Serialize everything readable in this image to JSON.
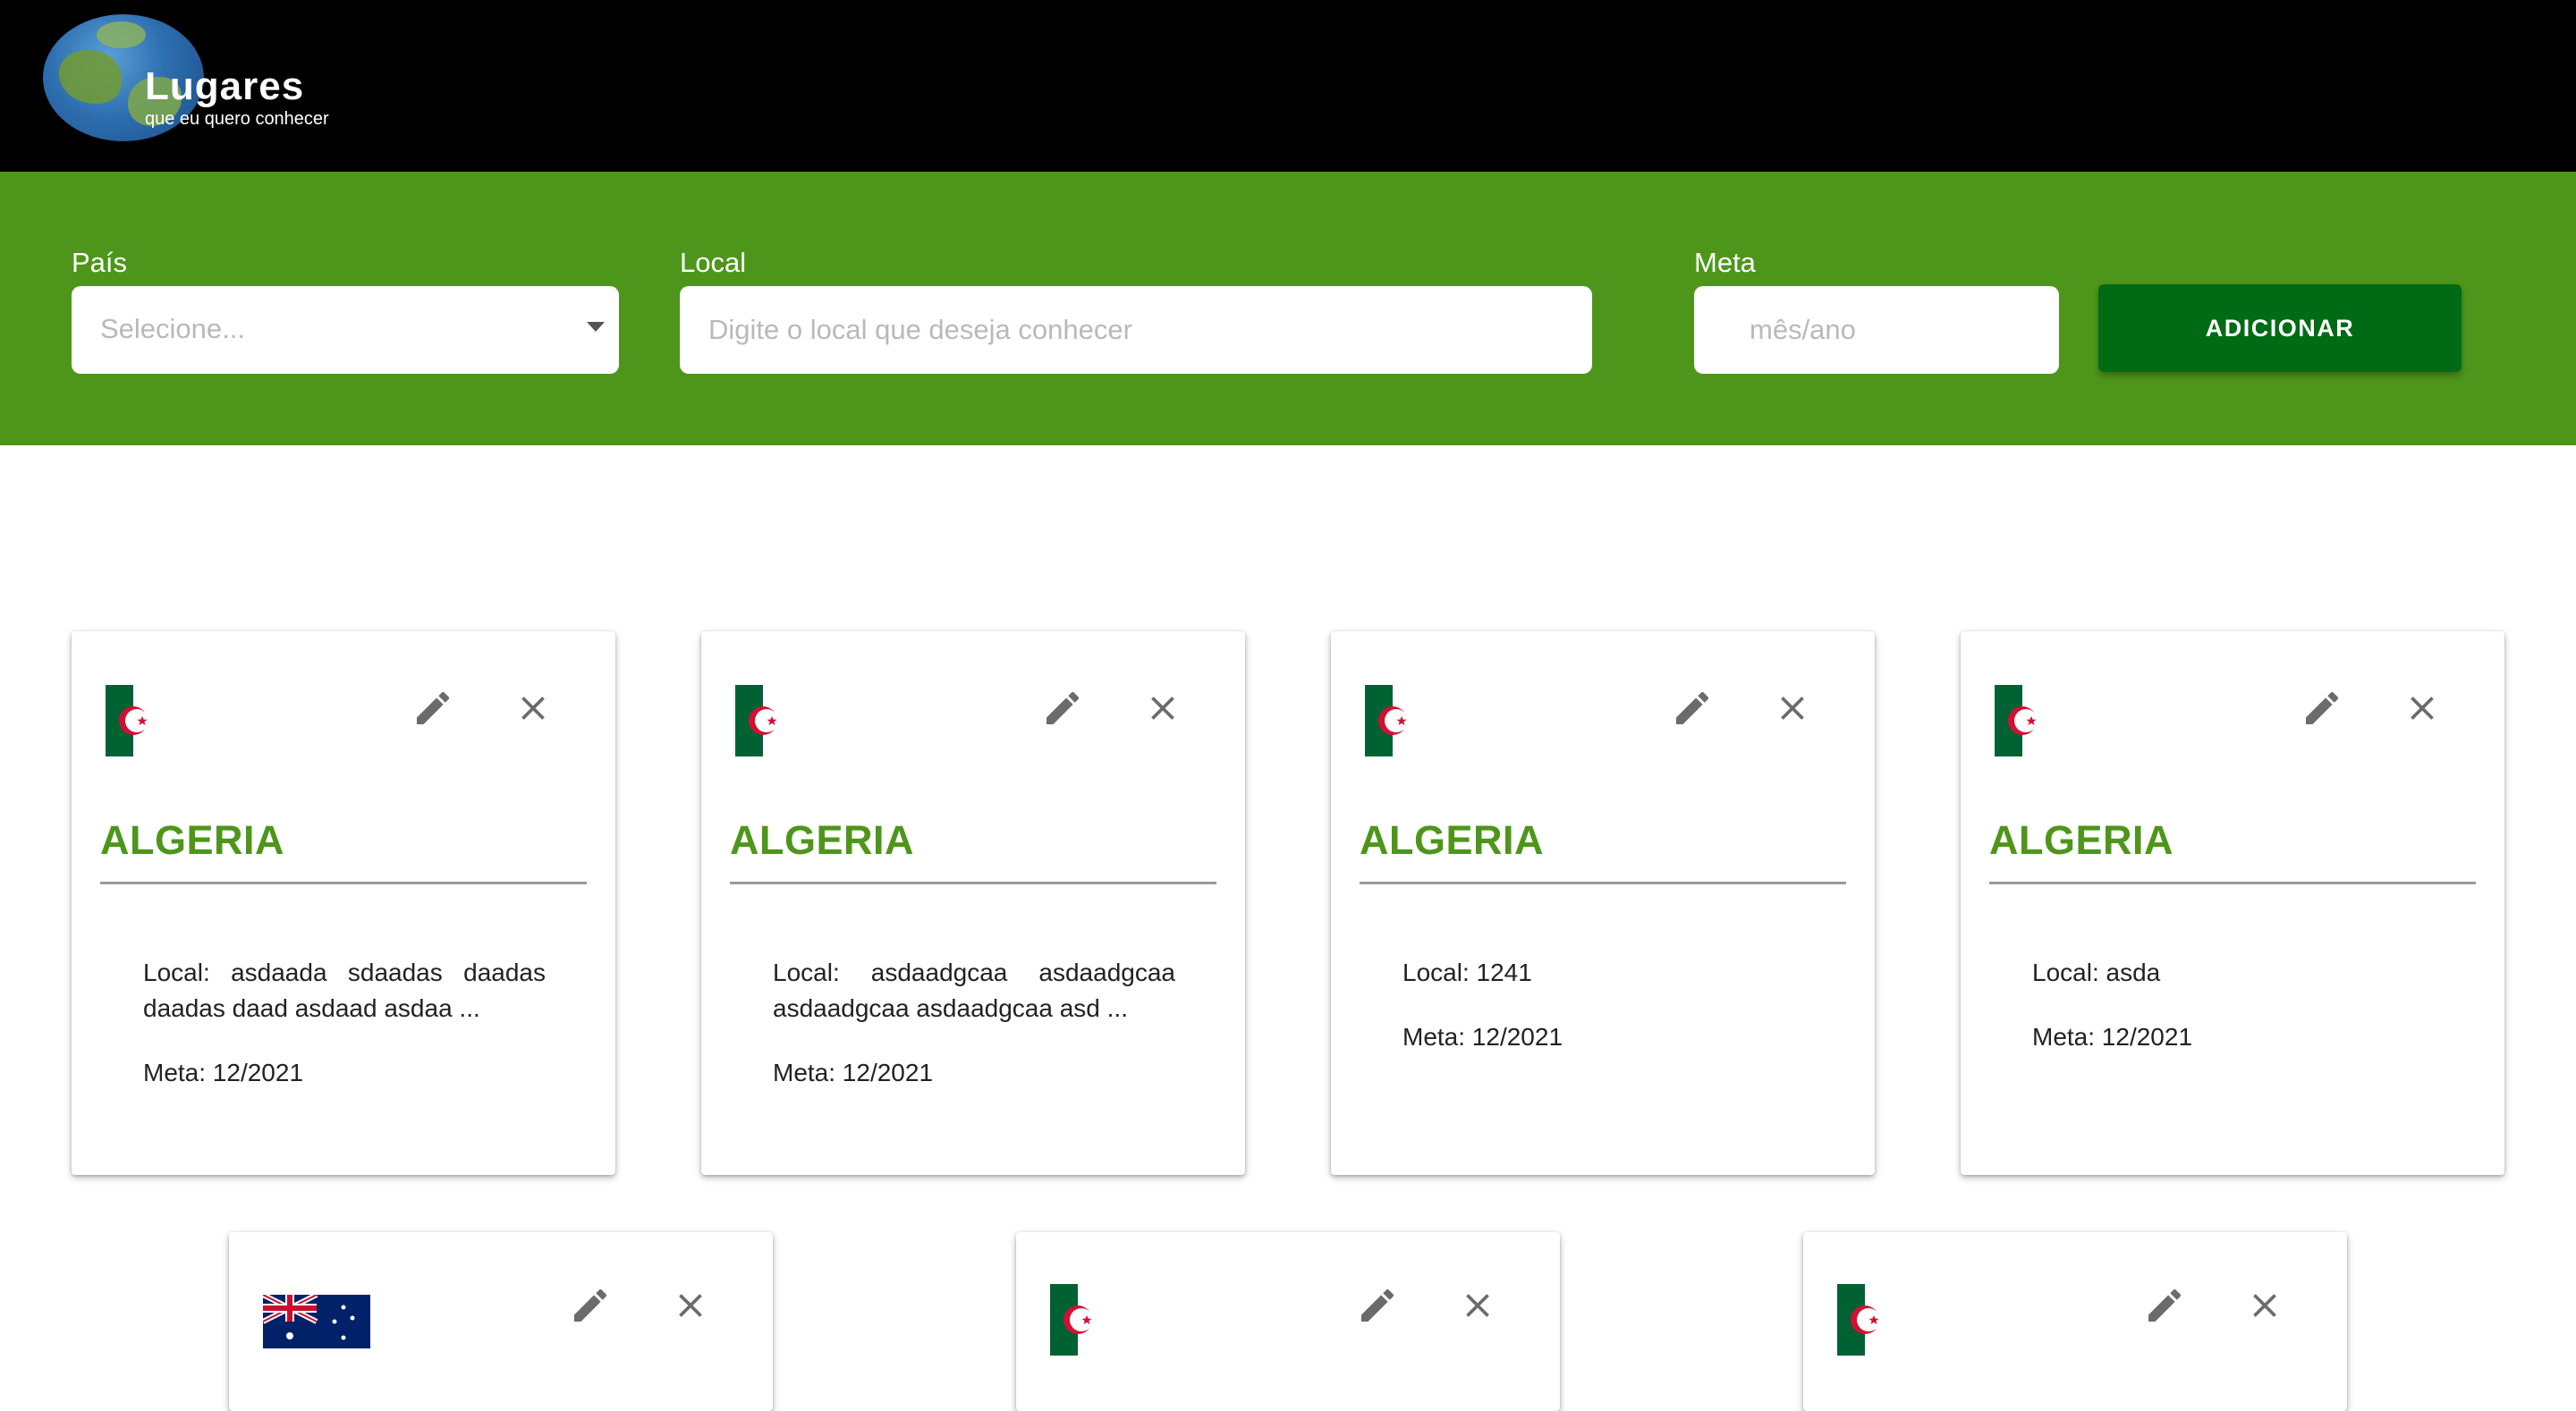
{
  "header": {
    "logo_title": "Lugares",
    "logo_subtitle": "que eu quero conhecer"
  },
  "form": {
    "country_label": "País",
    "country_placeholder": "Selecione...",
    "local_label": "Local",
    "local_placeholder": "Digite o local que deseja conhecer",
    "meta_label": "Meta",
    "meta_placeholder": "mês/ano",
    "add_button": "ADICIONAR"
  },
  "cards": [
    {
      "country": "ALGERIA",
      "flag": "algeria-flag",
      "local": "Local: asdaada sdaadas daadas daadas daad asdaad asdaa ...",
      "meta": "Meta: 12/2021"
    },
    {
      "country": "ALGERIA",
      "flag": "algeria-flag",
      "local": "Local: asdaadgcaa asdaadgcaa asdaadgcaa asdaadgcaa asd ...",
      "meta": "Meta: 12/2021"
    },
    {
      "country": "ALGERIA",
      "flag": "algeria-flag",
      "local": "Local: 1241",
      "meta": "Meta: 12/2021"
    },
    {
      "country": "ALGERIA",
      "flag": "algeria-flag",
      "local": "Local: asda",
      "meta": "Meta: 12/2021"
    },
    {
      "flag": "australia-flag"
    },
    {
      "flag": "algeria-flag"
    },
    {
      "flag": "algeria-flag"
    }
  ],
  "icons": {
    "edit": "pencil-icon",
    "remove": "close-icon"
  },
  "colors": {
    "header_bg": "#000000",
    "form_band": "#4e961b",
    "button": "#006b14",
    "title_green": "#4e961b"
  }
}
